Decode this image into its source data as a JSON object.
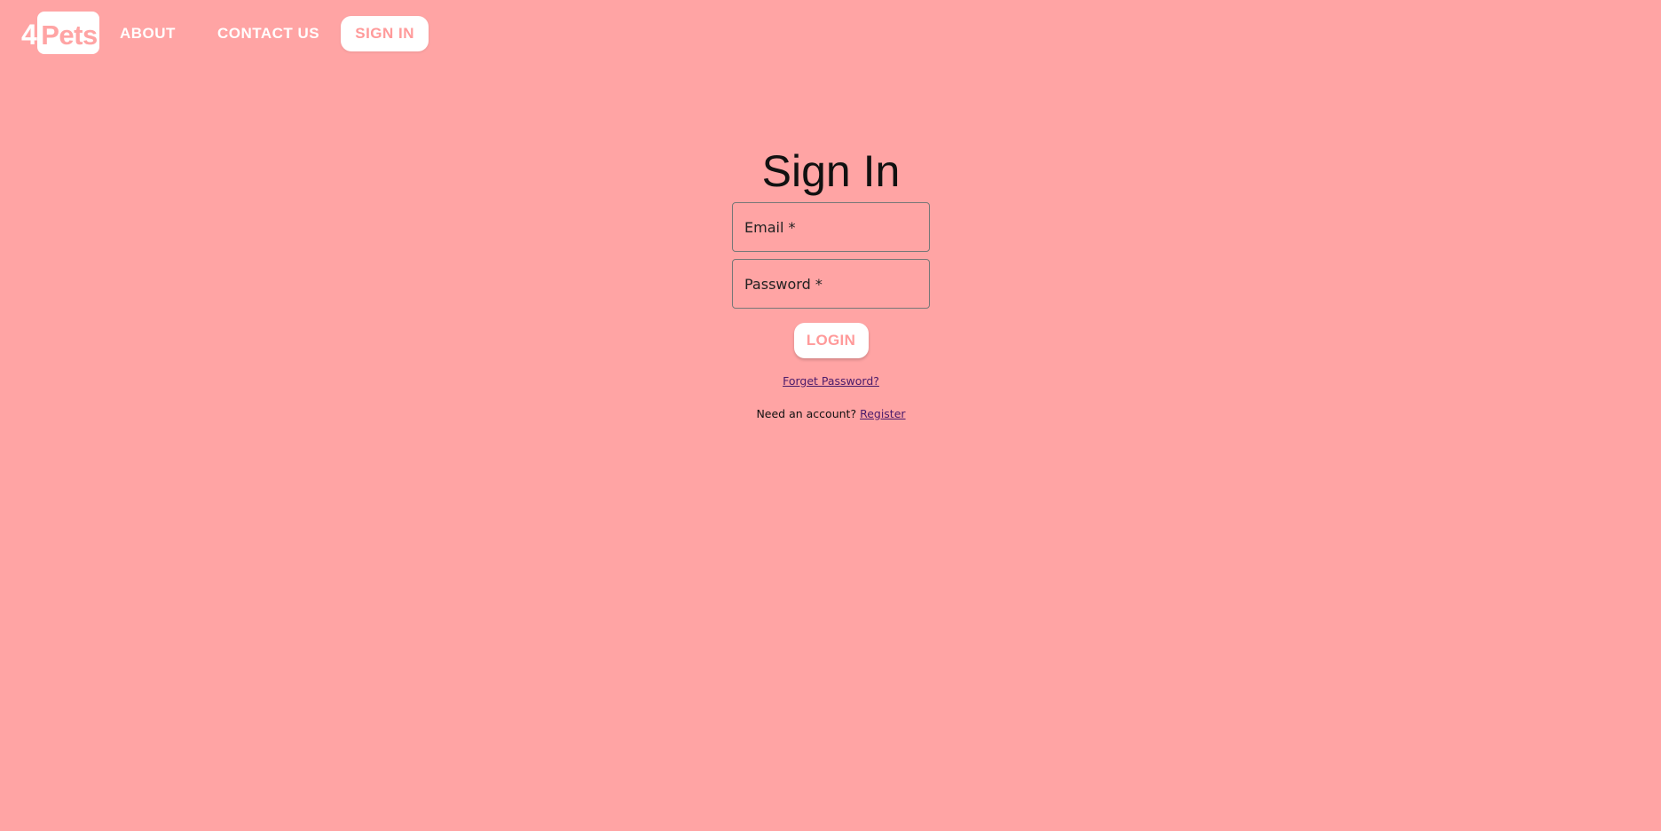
{
  "nav": {
    "logo": {
      "prefix": "4",
      "word": "Pets"
    },
    "about_label": "ABOUT",
    "contact_label": "CONTACT US",
    "signin_label": "SIGN IN"
  },
  "form": {
    "title": "Sign In",
    "email": {
      "label": "Email *",
      "value": ""
    },
    "password": {
      "label": "Password *",
      "value": ""
    },
    "login_label": "LOGIN",
    "forgot_label": "Forget Password?",
    "register_prompt": "Need an account?",
    "register_label": "Register"
  },
  "colors": {
    "background": "#ffa4a4",
    "accent": "#ff9a9a",
    "button_bg": "#ffffff",
    "link": "#4a1a6a"
  }
}
